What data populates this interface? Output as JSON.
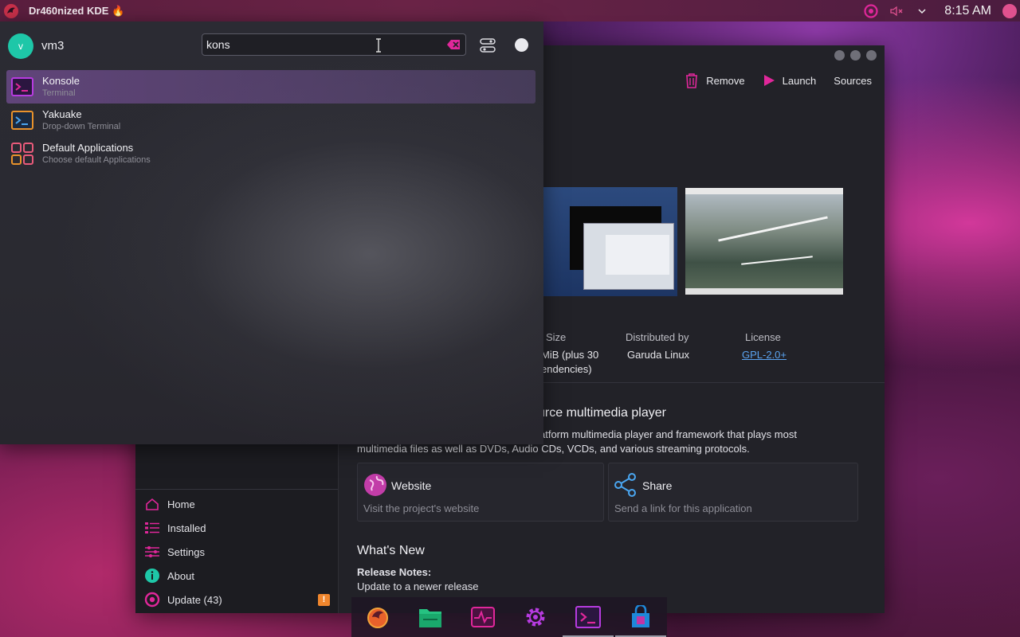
{
  "panel": {
    "title": "Dr460nized KDE 🔥",
    "clock": "8:15 AM"
  },
  "launcher": {
    "user": {
      "initial": "v",
      "name": "vm3"
    },
    "search": {
      "value": "kons"
    },
    "results": [
      {
        "name": "Konsole",
        "desc": "Terminal",
        "icon": "konsole-icon",
        "selected": true
      },
      {
        "name": "Yakuake",
        "desc": "Drop-down Terminal",
        "icon": "yakuake-icon",
        "selected": false
      },
      {
        "name": "Default Applications",
        "desc": "Choose default Applications",
        "icon": "default-apps-icon",
        "selected": false
      }
    ]
  },
  "discover": {
    "toolbar": {
      "remove": "Remove",
      "launch": "Launch",
      "sources": "Sources"
    },
    "meta": {
      "size_label": "Size",
      "size_value_1": "MiB (plus 30",
      "size_value_2": "endencies)",
      "distributor_label": "Distributed by",
      "distributor_value": "Garuda Linux",
      "license_label": "License",
      "license_value": "GPL-2.0+"
    },
    "headline": "urce multimedia player",
    "description_1": "atform multimedia player and framework that plays most",
    "description_2": "multimedia files as well as DVDs, Audio CDs, VCDs, and various streaming protocols.",
    "cards": [
      {
        "title": "Website",
        "subtitle": "Visit the project's website"
      },
      {
        "title": "Share",
        "subtitle": "Send a link for this application"
      }
    ],
    "whats_new": {
      "heading": "What's New",
      "notes_label": "Release Notes:",
      "notes_text": "Update to a newer release"
    },
    "nav": [
      {
        "label": "Home",
        "icon": "home-icon"
      },
      {
        "label": "Installed",
        "icon": "installed-list-icon"
      },
      {
        "label": "Settings",
        "icon": "settings-sliders-icon"
      },
      {
        "label": "About",
        "icon": "info-icon"
      },
      {
        "label": "Update (43)",
        "icon": "update-icon",
        "badge": "!"
      }
    ]
  },
  "dock": [
    "firedragon-icon",
    "files-icon",
    "system-monitor-icon",
    "settings-gear-icon",
    "konsole-icon",
    "discover-store-icon"
  ],
  "colors": {
    "accent": "#e0279a",
    "selection": "#7e5aa8",
    "teal": "#1ec7a8"
  }
}
